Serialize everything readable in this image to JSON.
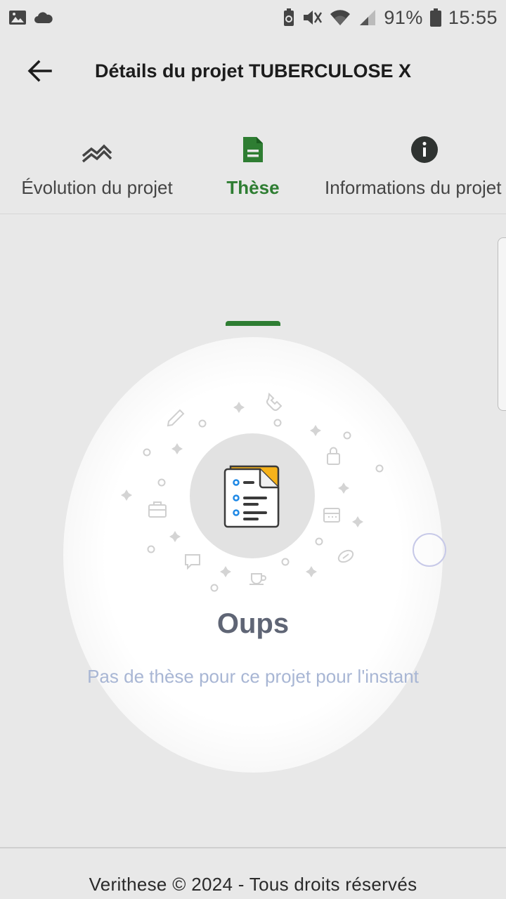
{
  "status_bar": {
    "battery": "91%",
    "time": "15:55",
    "icons": [
      "image-icon",
      "cloud-icon",
      "battery-saver-icon",
      "mute-icon",
      "wifi-icon",
      "signal-icon",
      "battery-icon"
    ]
  },
  "app_bar": {
    "title": "Détails du projet TUBERCULOSE X",
    "back_icon": "arrow-left-icon"
  },
  "tabs": [
    {
      "label": "Évolution du projet",
      "icon": "trending-icon",
      "active": false
    },
    {
      "label": "Thèse",
      "icon": "document-icon",
      "active": true
    },
    {
      "label": "Informations du projet",
      "icon": "info-icon",
      "active": false
    }
  ],
  "empty_state": {
    "title": "Oups",
    "message": "Pas de thèse pour ce projet pour l'instant",
    "illustration": "empty-document-icon"
  },
  "footer": {
    "text": "Verithese © 2024 - Tous droits réservés"
  },
  "colors": {
    "accent": "#2e7d32",
    "background": "#e8e8e8",
    "empty_title": "#5f6575",
    "empty_message": "#a8b6d4"
  }
}
